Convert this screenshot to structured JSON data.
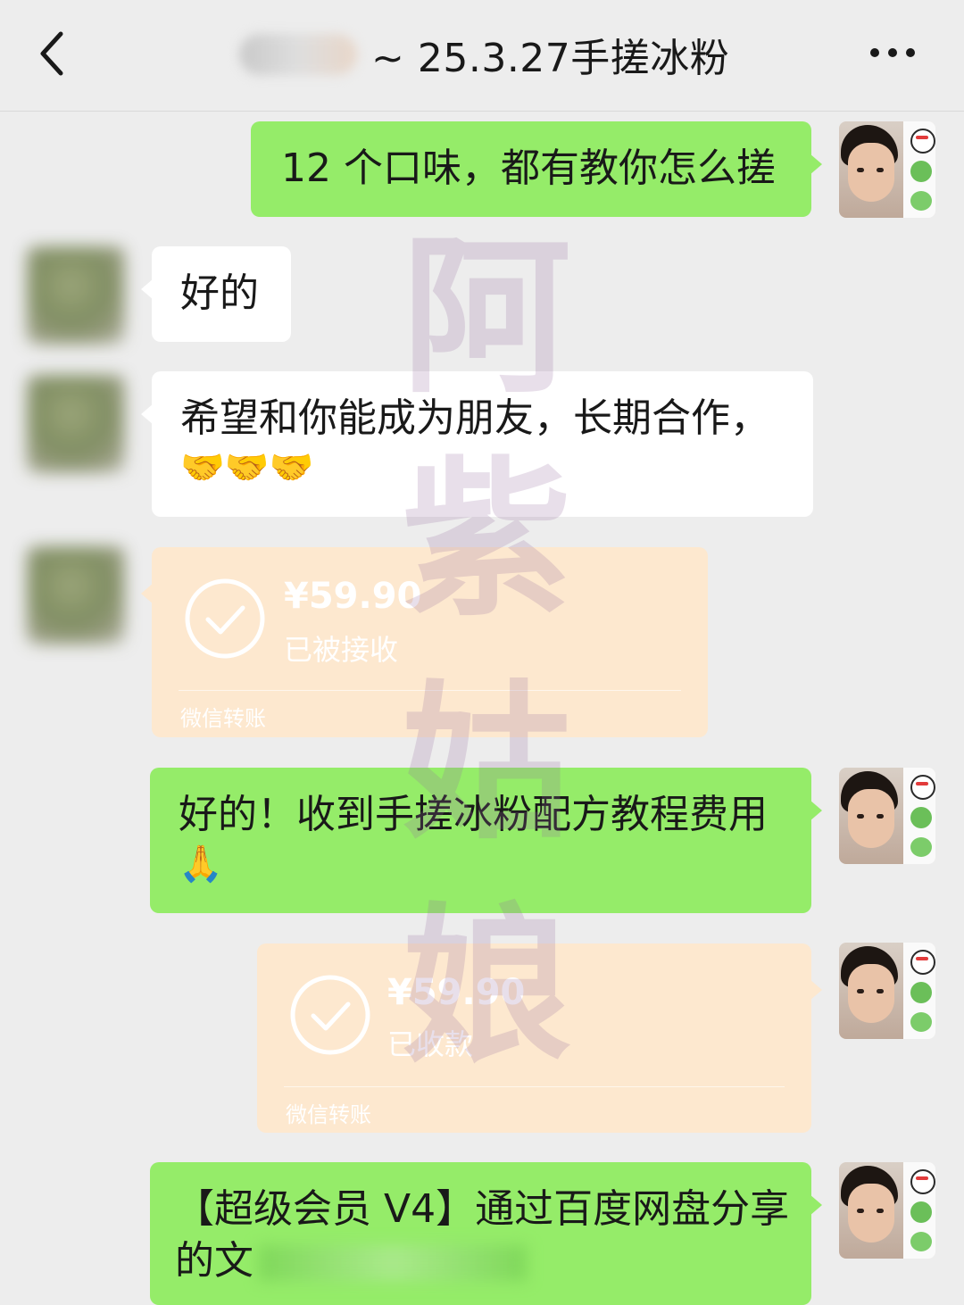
{
  "header": {
    "title": "~ 25.3.27手搓冰粉"
  },
  "watermark": [
    "阿",
    "紫",
    "姑",
    "娘"
  ],
  "messages": {
    "m1": {
      "text": "12 个口味，都有教你怎么搓"
    },
    "m2": {
      "text": "好的"
    },
    "m3": {
      "line1": "希望和你能成为朋友，长期合作，",
      "emojis": "🤝🤝🤝"
    },
    "m4": {
      "amount": "¥59.90",
      "status": "已被接收",
      "footer": "微信转账"
    },
    "m5": {
      "line1": "好的！收到手搓冰粉配方教程费用",
      "emoji": "🙏"
    },
    "m6": {
      "amount": "¥59.90",
      "status": "已收款",
      "footer": "微信转账"
    },
    "m7": {
      "line1": "【超级会员 V4】通过百度网盘分享",
      "line2": "的文"
    }
  },
  "icons": {
    "back": "chevron-left-icon",
    "more": "more-dots-icon",
    "transfer_done": "check-circle-icon"
  },
  "colors": {
    "background": "#ededed",
    "bubble_self": "#95ec69",
    "bubble_other": "#ffffff",
    "transfer_card": "#fde8cf"
  }
}
